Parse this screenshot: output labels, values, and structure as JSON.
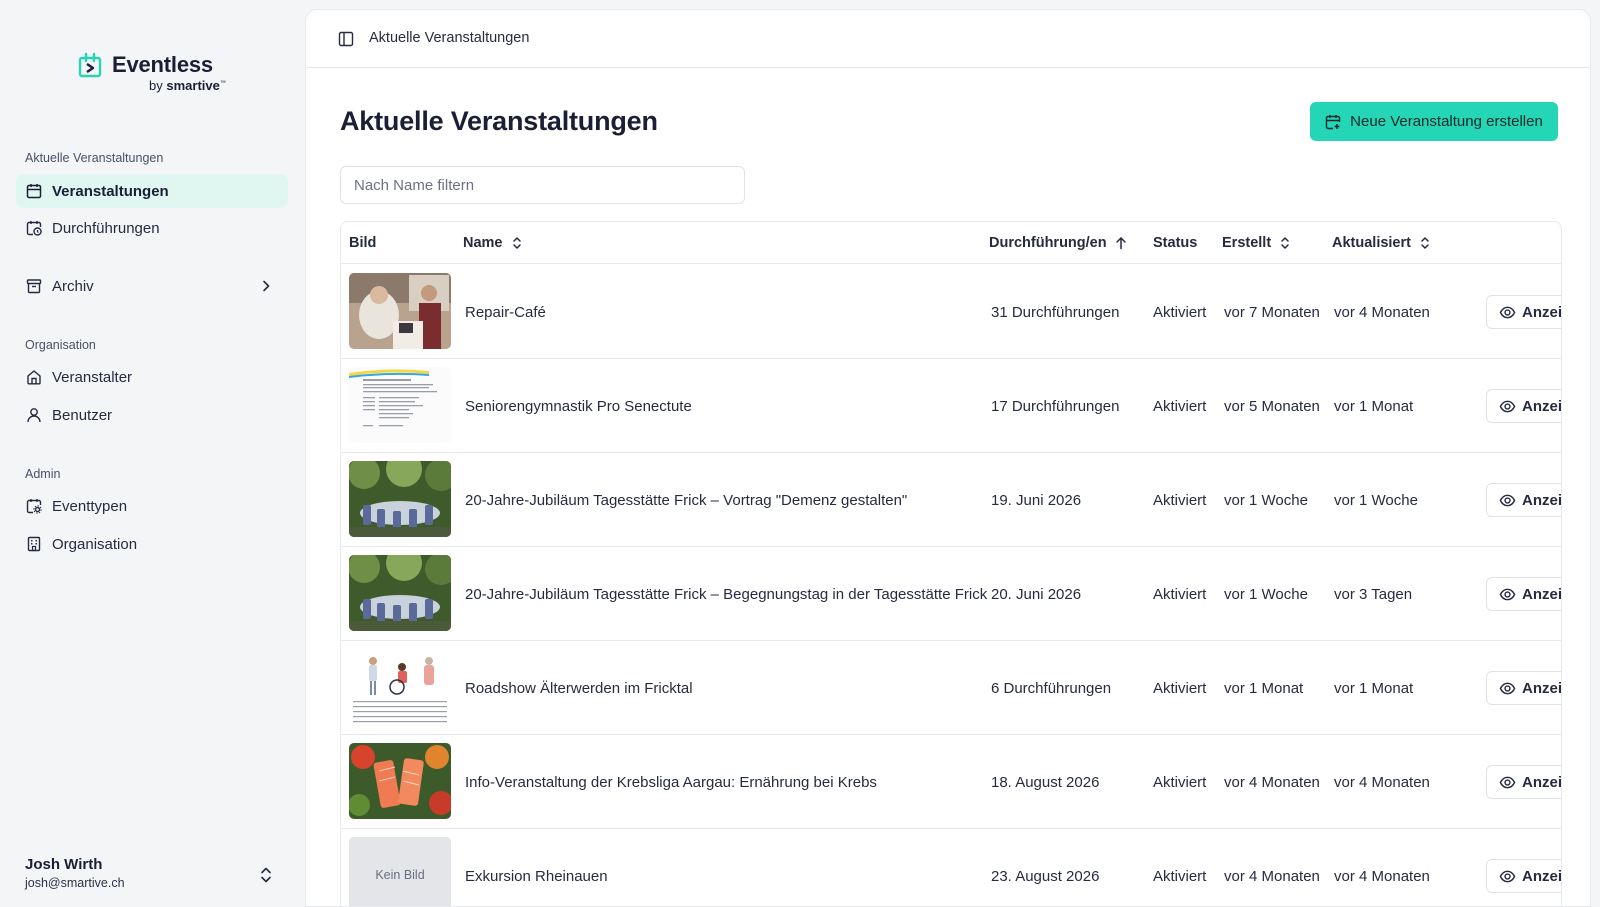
{
  "brand": {
    "name": "Eventless",
    "sub_prefix": "by",
    "sub_brand": "smartive",
    "sub_mark": "™",
    "accent": "#25d6b6"
  },
  "sidebar": {
    "groups": [
      {
        "title": "Aktuelle Veranstaltungen"
      },
      {
        "title": "Organisation"
      },
      {
        "title": "Admin"
      }
    ],
    "items": {
      "veranstaltungen": "Veranstaltungen",
      "durchfuehrungen": "Durchführungen",
      "archiv": "Archiv",
      "veranstalter": "Veranstalter",
      "benutzer": "Benutzer",
      "eventtypen": "Eventtypen",
      "organisation": "Organisation"
    },
    "user": {
      "name": "Josh Wirth",
      "email": "josh@smartive.ch"
    }
  },
  "topbar": {
    "title": "Aktuelle Veranstaltungen"
  },
  "page": {
    "title": "Aktuelle Veranstaltungen",
    "create_label": "Neue Veranstaltung erstellen",
    "filter_placeholder": "Nach Name filtern",
    "filter_value": ""
  },
  "table": {
    "headers": {
      "bild": "Bild",
      "name": "Name",
      "durchfuehrung": "Durchführung/en",
      "status": "Status",
      "erstellt": "Erstellt",
      "aktualisiert": "Aktualisiert"
    },
    "view_label": "Anzeigen",
    "no_image_label": "Kein Bild",
    "rows": [
      {
        "name": "Repair-Café",
        "durchfuehrung": "31 Durchführungen",
        "status": "Aktiviert",
        "erstellt": "vor 7 Monaten",
        "aktualisiert": "vor 4 Monaten",
        "image": "photo-workshop"
      },
      {
        "name": "Seniorengymnastik Pro Senectute",
        "durchfuehrung": "17 Durchführungen",
        "status": "Aktiviert",
        "erstellt": "vor 5 Monaten",
        "aktualisiert": "vor 1 Monat",
        "image": "document-flyer"
      },
      {
        "name": "20-Jahre-Jubiläum Tagesstätte Frick – Vortrag \"Demenz gestalten\"",
        "durchfuehrung": "19. Juni 2026",
        "status": "Aktiviert",
        "erstellt": "vor 1 Woche",
        "aktualisiert": "vor 1 Woche",
        "image": "photo-garden"
      },
      {
        "name": "20-Jahre-Jubiläum Tagesstätte Frick – Begegnungstag in der Tagesstätte Frick",
        "durchfuehrung": "20. Juni 2026",
        "status": "Aktiviert",
        "erstellt": "vor 1 Woche",
        "aktualisiert": "vor 3 Tagen",
        "image": "photo-garden"
      },
      {
        "name": "Roadshow Älterwerden im Fricktal",
        "durchfuehrung": "6 Durchführungen",
        "status": "Aktiviert",
        "erstellt": "vor 1 Monat",
        "aktualisiert": "vor 1 Monat",
        "image": "illustration-people"
      },
      {
        "name": "Info-Veranstaltung der Krebsliga Aargau: Ernährung bei Krebs",
        "durchfuehrung": "18. August 2026",
        "status": "Aktiviert",
        "erstellt": "vor 4 Monaten",
        "aktualisiert": "vor 4 Monaten",
        "image": "photo-food"
      },
      {
        "name": "Exkursion Rheinauen",
        "durchfuehrung": "23. August 2026",
        "status": "Aktiviert",
        "erstellt": "vor 4 Monaten",
        "aktualisiert": "vor 4 Monaten",
        "image": "none"
      }
    ]
  }
}
